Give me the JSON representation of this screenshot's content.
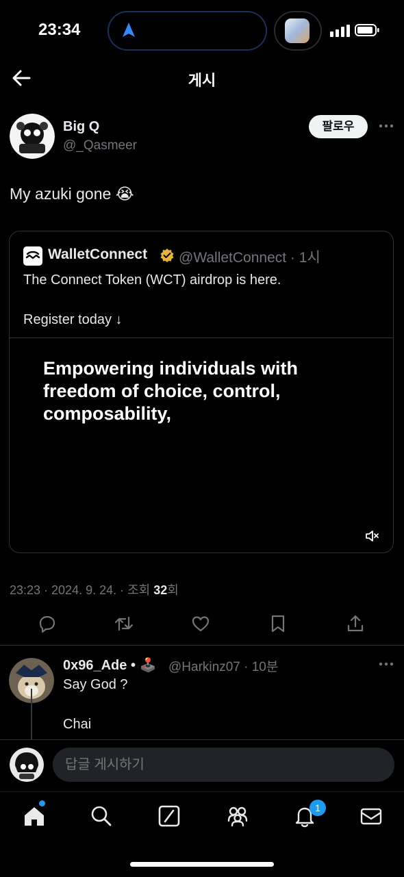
{
  "status_bar": {
    "time": "23:34"
  },
  "header": {
    "title": "게시"
  },
  "post": {
    "author_name": "Big Q",
    "author_handle": "@_Qasmeer",
    "follow_label": "팔로우",
    "text": "My azuki gone 😭",
    "meta_prefix": "23:23 · 2024. 9. 24. · 조회 ",
    "views": "32",
    "meta_suffix": "회"
  },
  "quote": {
    "name": "WalletConnect",
    "handle_time": "@WalletConnect · 1시",
    "text_line1": "The Connect Token (WCT) airdrop is here.",
    "text_line2": "Register today ↓",
    "media_text": "Empowering individuals with freedom of choice, control, composability,"
  },
  "reply": {
    "name": "0x96_Ade • 🕹️",
    "handle_time": "@Harkinz07 · 10분",
    "text_line1": "Say God ?",
    "text_line2": "Chai"
  },
  "compose": {
    "placeholder": "답글 게시하기"
  },
  "bottom_nav": {
    "notification_count": "1"
  },
  "colors": {
    "accent": "#1d9bf0",
    "background": "#000000",
    "verified": "#e8b52e"
  }
}
